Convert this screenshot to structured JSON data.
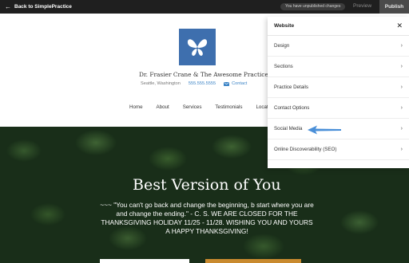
{
  "topbar": {
    "back_label": "Back to SimplePractice",
    "unpublished_label": "You have unpublished changes",
    "preview_label": "Preview",
    "publish_label": "Publish"
  },
  "site": {
    "practice_name": "Dr. Frasier Crane & The Awesome Practice",
    "location": "Seattle, Washington",
    "phone": "555.555.5555",
    "contact_label": "Contact",
    "nav": [
      "Home",
      "About",
      "Services",
      "Testimonials",
      "Locat"
    ]
  },
  "hero": {
    "title": "Best Version of You",
    "text": "~~~ \"You can't go back and change the beginning, b start where you are and change the ending.\" - C. S. WE ARE CLOSED FOR THE THANKSGIVING HOLIDAY 11/25 - 11/28. WISHING YOU AND YOURS A HAPPY THANKSGIVING!"
  },
  "panel": {
    "title": "Website",
    "items": [
      {
        "label": "Design"
      },
      {
        "label": "Sections"
      },
      {
        "label": "Practice Details"
      },
      {
        "label": "Contact Options"
      },
      {
        "label": "Social Media"
      },
      {
        "label": "Online Discoverability (SEO)"
      }
    ]
  },
  "colors": {
    "accent_blue": "#3e6fae",
    "link_blue": "#3c84c6",
    "pointer_blue": "#4a8fd8",
    "cta_gold": "#c98a2f"
  }
}
